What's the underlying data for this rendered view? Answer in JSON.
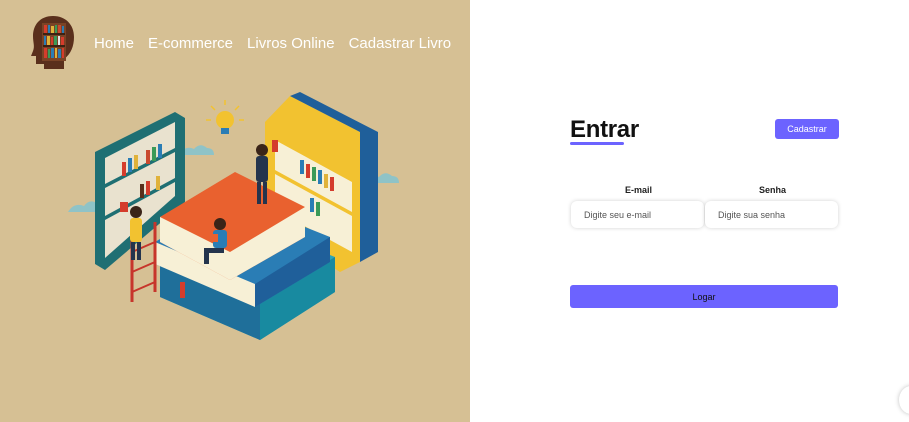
{
  "nav": {
    "items": [
      {
        "label": "Home"
      },
      {
        "label": "E-commerce"
      },
      {
        "label": "Livros Online"
      },
      {
        "label": "Cadastrar Livro"
      }
    ]
  },
  "login": {
    "title": "Entrar",
    "register_button": "Cadastrar",
    "email_label": "E-mail",
    "email_placeholder": "Digite seu e-mail",
    "password_label": "Senha",
    "password_placeholder": "Digite sua senha",
    "submit_button": "Logar"
  },
  "colors": {
    "left_background": "#d6c094",
    "accent": "#6c63ff"
  },
  "icons": {
    "logo": "head-bookshelf-logo",
    "illustration": "books-reading-illustration"
  }
}
